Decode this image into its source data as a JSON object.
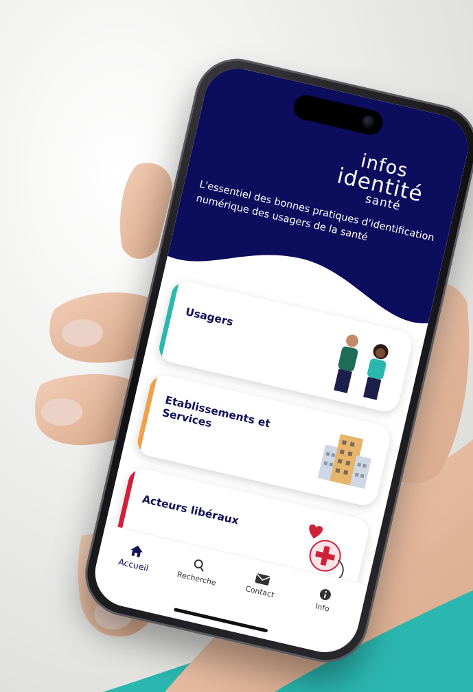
{
  "app": {
    "logo": {
      "line1": "infos",
      "line2": "identité",
      "line3": "santé"
    },
    "tagline": "L'essentiel des bonnes pratiques d'identification numérique des usagers de la santé"
  },
  "cards": [
    {
      "label": "Usagers",
      "accent": "#2bb7b0",
      "icon": "people-illustration"
    },
    {
      "label": "Etablissements et Services",
      "accent": "#f0a04b",
      "icon": "building-illustration"
    },
    {
      "label": "Acteurs libéraux",
      "accent": "#d0213c",
      "icon": "medical-illustration"
    }
  ],
  "tabs": [
    {
      "label": "Accueil",
      "icon": "home-icon",
      "active": true
    },
    {
      "label": "Recherche",
      "icon": "search-icon",
      "active": false
    },
    {
      "label": "Contact",
      "icon": "mail-icon",
      "active": false
    },
    {
      "label": "Info",
      "icon": "info-icon",
      "active": false
    }
  ],
  "colors": {
    "navy": "#0d0d5e",
    "teal": "#2bb7b0",
    "orange": "#f0a04b",
    "red": "#d0213c"
  }
}
